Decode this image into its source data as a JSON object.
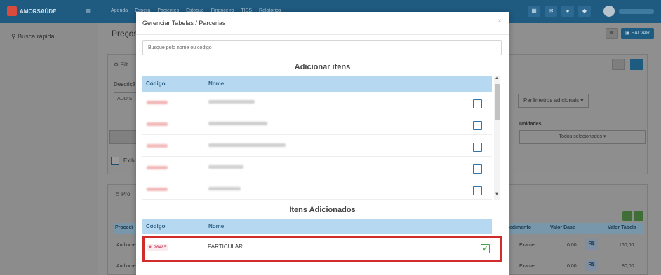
{
  "app": {
    "logo_text": "AMORSAÚDE",
    "topnav": [
      "Agenda",
      "Espera",
      "Pacientes",
      "Estoque",
      "Financeiro",
      "TISS",
      "Relatórios"
    ],
    "quick_search_label": "Busca rápida...",
    "page_title": "Preços",
    "save_button": "SALVAR"
  },
  "background": {
    "filter_label": "Filt",
    "description_label": "Descriçã",
    "description_value": "AUDIS",
    "exhibit_label": "Exibi",
    "params_button": "Parâmetros adicionais",
    "units_label": "Unidades",
    "units_select": "Todos selecionados",
    "procedures_label": "Pro",
    "table_headers": [
      "Procedi",
      "cedimento",
      "Valor Base",
      "Valor Tabela"
    ],
    "rows": [
      {
        "name": "Audiome",
        "type": "Exame",
        "base": "0,00",
        "currency": "R$",
        "table": "160,00"
      },
      {
        "name": "Audiome",
        "type": "Exame",
        "base": "0,00",
        "currency": "R$",
        "table": "80,00"
      }
    ]
  },
  "modal": {
    "title": "Gerenciar Tabelas / Parcerias",
    "search_placeholder": "Busque pelo nome ou código",
    "add_section_title": "Adicionar itens",
    "added_section_title": "Itens Adicionados",
    "columns": {
      "code": "Código",
      "name": "Nome"
    },
    "available_items_count": 5,
    "added_items": [
      {
        "code": "# 20485",
        "name": "PARTICULAR",
        "checked": true
      }
    ]
  }
}
